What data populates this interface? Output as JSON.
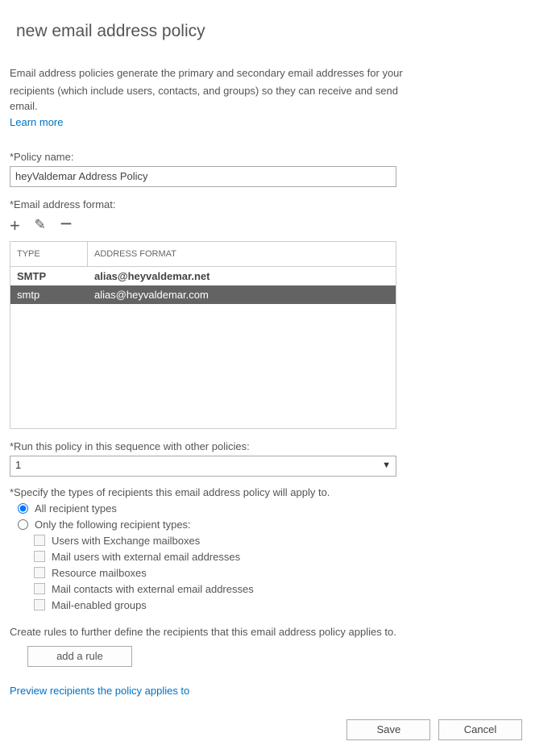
{
  "title": "new email address policy",
  "description_line1": "Email address policies generate the primary and secondary email addresses for your",
  "description_line2": "recipients (which include users, contacts, and groups) so they can receive and send email.",
  "learn_more": "Learn more",
  "policy_name_label": "*Policy name:",
  "policy_name_value": "heyValdemar Address Policy",
  "email_format_label": "*Email address format:",
  "grid_headers": {
    "type": "TYPE",
    "format": "ADDRESS FORMAT"
  },
  "grid_rows": [
    {
      "type": "SMTP",
      "format": "alias@heyvaldemar.net",
      "selected": false
    },
    {
      "type": "smtp",
      "format": "alias@heyvaldemar.com",
      "selected": true
    }
  ],
  "sequence_label": "*Run this policy in this sequence with other policies:",
  "sequence_value": "1",
  "recipient_types_label": "*Specify the types of recipients this email address policy will apply to.",
  "radio_all": "All recipient types",
  "radio_only": "Only the following recipient types:",
  "checkboxes": [
    "Users with Exchange mailboxes",
    "Mail users with external email addresses",
    "Resource mailboxes",
    "Mail contacts with external email addresses",
    "Mail-enabled groups"
  ],
  "rules_text": "Create rules to further define the recipients that this email address policy applies to.",
  "add_rule_label": "add a rule",
  "preview_link": "Preview recipients the policy applies to",
  "save_label": "Save",
  "cancel_label": "Cancel"
}
